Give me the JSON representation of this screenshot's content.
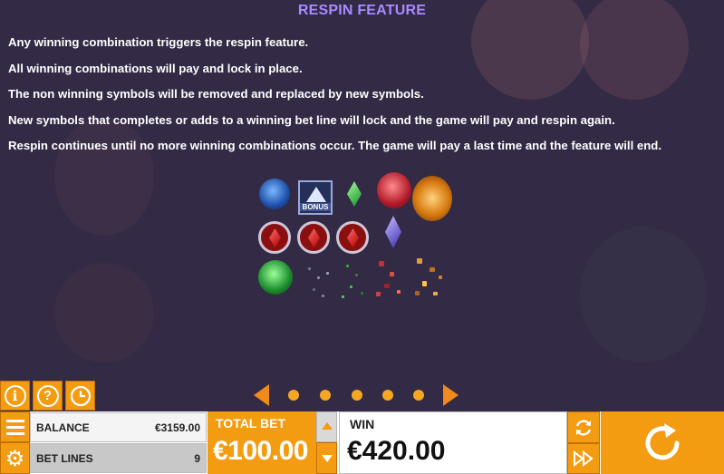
{
  "page": {
    "title": "RESPIN FEATURE",
    "rules": [
      "Any winning combination triggers the respin feature.",
      "All winning combinations will pay and lock in place.",
      "The non winning symbols will be removed and replaced by new symbols.",
      "New symbols that completes or adds to a winning bet line will lock and the game will pay and respin again.",
      "Respin continues until no more winning combinations occur. The game will pay a last time and the feature will end."
    ]
  },
  "illustration": {
    "bonus_label": "BONUS",
    "symbols": [
      "blue-wolf-icon",
      "bonus-mountain-icon",
      "green-gem-icon",
      "red-wolf-icon",
      "golden-stag-icon",
      "red-gem-icon",
      "red-gem-icon",
      "red-gem-icon",
      "purple-gem-icon",
      "green-wolf-icon"
    ]
  },
  "pager": {
    "pages": 5
  },
  "toolbar": {
    "info_glyph": "i",
    "help_glyph": "?"
  },
  "bottom": {
    "balance_label": "BALANCE",
    "balance_value": "€3159.00",
    "bet_lines_label": "BET LINES",
    "bet_lines_value": "9",
    "total_bet_label": "TOTAL BET",
    "total_bet_value": "€100.00",
    "win_label": "WIN",
    "win_value": "€420.00"
  },
  "colors": {
    "accent": "#f39c12",
    "background": "#332a45",
    "title": "#a98bff"
  }
}
